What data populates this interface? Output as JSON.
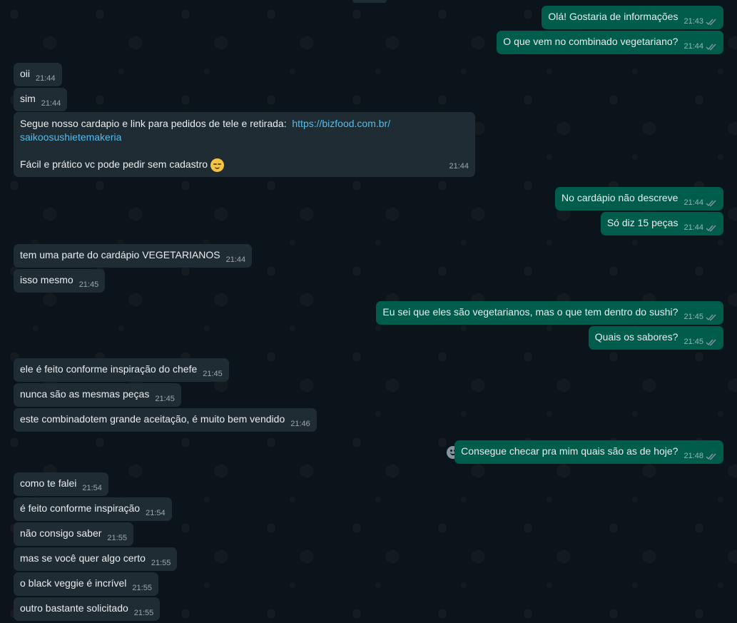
{
  "chat": {
    "messages": [
      {
        "text": "Olá! Gostaria de informações",
        "time": "21:43"
      },
      {
        "text": "O que vem no combinado vegetariano?",
        "time": "21:44"
      },
      {
        "text": "oii",
        "time": "21:44"
      },
      {
        "text": "sim",
        "time": "21:44"
      },
      {
        "line1": "Segue nosso cardapio e link para pedidos de tele e retirada:",
        "link1": "https://bizfood.com.br/",
        "link2": "saikoosushietemakeria",
        "line3": "Fácil e prático vc pode pedir sem cadastro",
        "time": "21:44"
      },
      {
        "text": "No cardápio não descreve",
        "time": "21:44"
      },
      {
        "text": "Só diz 15 peças",
        "time": "21:44"
      },
      {
        "text": "tem uma parte do cardápio VEGETARIANOS",
        "time": "21:44"
      },
      {
        "text": "isso mesmo",
        "time": "21:45"
      },
      {
        "text": "Eu sei que eles são vegetarianos, mas o que tem dentro do sushi?",
        "time": "21:45"
      },
      {
        "text": "Quais os sabores?",
        "time": "21:45"
      },
      {
        "text": "ele é feito conforme inspiração do chefe",
        "time": "21:45"
      },
      {
        "text": "nunca são as mesmas peças",
        "time": "21:45"
      },
      {
        "text": "este combinadotem grande aceitação, é muito bem vendido",
        "time": "21:46"
      },
      {
        "text": "Consegue checar pra mim quais são as de hoje?",
        "time": "21:48"
      },
      {
        "text": "como te falei",
        "time": "21:54"
      },
      {
        "text": "é feito conforme inspiração",
        "time": "21:54"
      },
      {
        "text": "não consigo saber",
        "time": "21:55"
      },
      {
        "text": "mas se você quer algo certo",
        "time": "21:55"
      },
      {
        "text": "o black veggie é incrível",
        "time": "21:55"
      },
      {
        "text": "outro bastante solicitado",
        "time": "21:55"
      }
    ]
  },
  "icons": {
    "read_ticks": "double-check-icon",
    "reaction": "smiley-reaction-icon",
    "emoji": "smirking-face-emoji"
  },
  "colors": {
    "background": "#0b141a",
    "incoming_bubble": "#202c33",
    "outgoing_bubble": "#005c4b",
    "link": "#53bdeb",
    "read_ticks": "#8696a0"
  }
}
